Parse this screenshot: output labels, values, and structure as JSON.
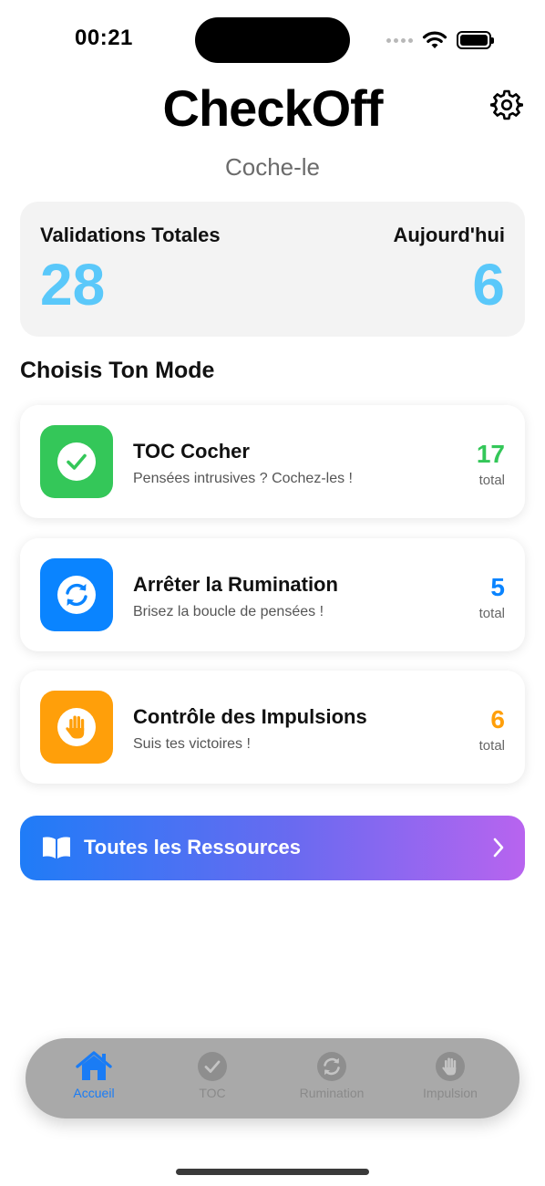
{
  "status_bar": {
    "time": "00:21"
  },
  "header": {
    "title": "CheckOff",
    "subtitle": "Coche-le",
    "settings_icon": "gear-icon"
  },
  "stats": {
    "total_label": "Validations Totales",
    "total_value": "28",
    "today_label": "Aujourd'hui",
    "today_value": "6",
    "value_color": "#5ac8fa"
  },
  "modes_section": {
    "title": "Choisis Ton Mode",
    "items": [
      {
        "title": "TOC Cocher",
        "description": "Pensées intrusives ? Cochez-les !",
        "count": "17",
        "unit": "total",
        "icon": "checkmark-circle-icon",
        "color": "#34c759"
      },
      {
        "title": "Arrêter la Rumination",
        "description": "Brisez la boucle de pensées !",
        "count": "5",
        "unit": "total",
        "icon": "refresh-circle-icon",
        "color": "#0a84ff"
      },
      {
        "title": "Contrôle des Impulsions",
        "description": "Suis tes victoires !",
        "count": "6",
        "unit": "total",
        "icon": "hand-raised-icon",
        "color": "#ff9f0a"
      }
    ]
  },
  "resources": {
    "label": "Toutes les Ressources",
    "icon": "book-icon"
  },
  "tabbar": {
    "items": [
      {
        "label": "Accueil",
        "icon": "house-icon",
        "active": true
      },
      {
        "label": "TOC",
        "icon": "checkmark-circle-icon",
        "active": false
      },
      {
        "label": "Rumination",
        "icon": "refresh-circle-icon",
        "active": false
      },
      {
        "label": "Impulsion",
        "icon": "hand-raised-icon",
        "active": false
      }
    ]
  }
}
